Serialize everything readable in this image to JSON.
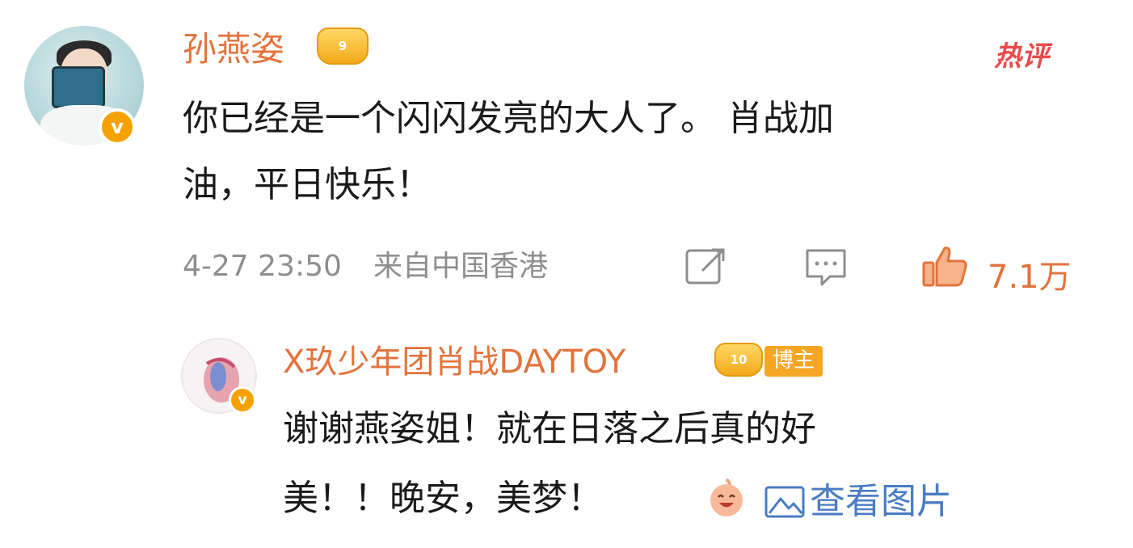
{
  "comment": {
    "username": "孙燕姿",
    "level_badge": "9",
    "hot_label": "热评",
    "text_line1": "你已经是一个闪闪发亮的大人了。 肖战加",
    "text_line2": "油，平日快乐！",
    "timestamp": "4-27 23:50",
    "location": "来自中国香港",
    "like_count": "7.1万",
    "icons": [
      "share-icon",
      "comment-icon",
      "like-icon"
    ],
    "accent_color": "#e2733c"
  },
  "reply": {
    "username": "X玖少年团肖战DAYTOY",
    "level_badge": "10",
    "role_badge": "博主",
    "text_line1": "谢谢燕姿姐！就在日落之后真的好",
    "text_line2": "美！！晚安，美梦！",
    "emoji": "laughing-emoji",
    "view_image_label": "查看图片",
    "link_color": "#4a7cc3"
  }
}
